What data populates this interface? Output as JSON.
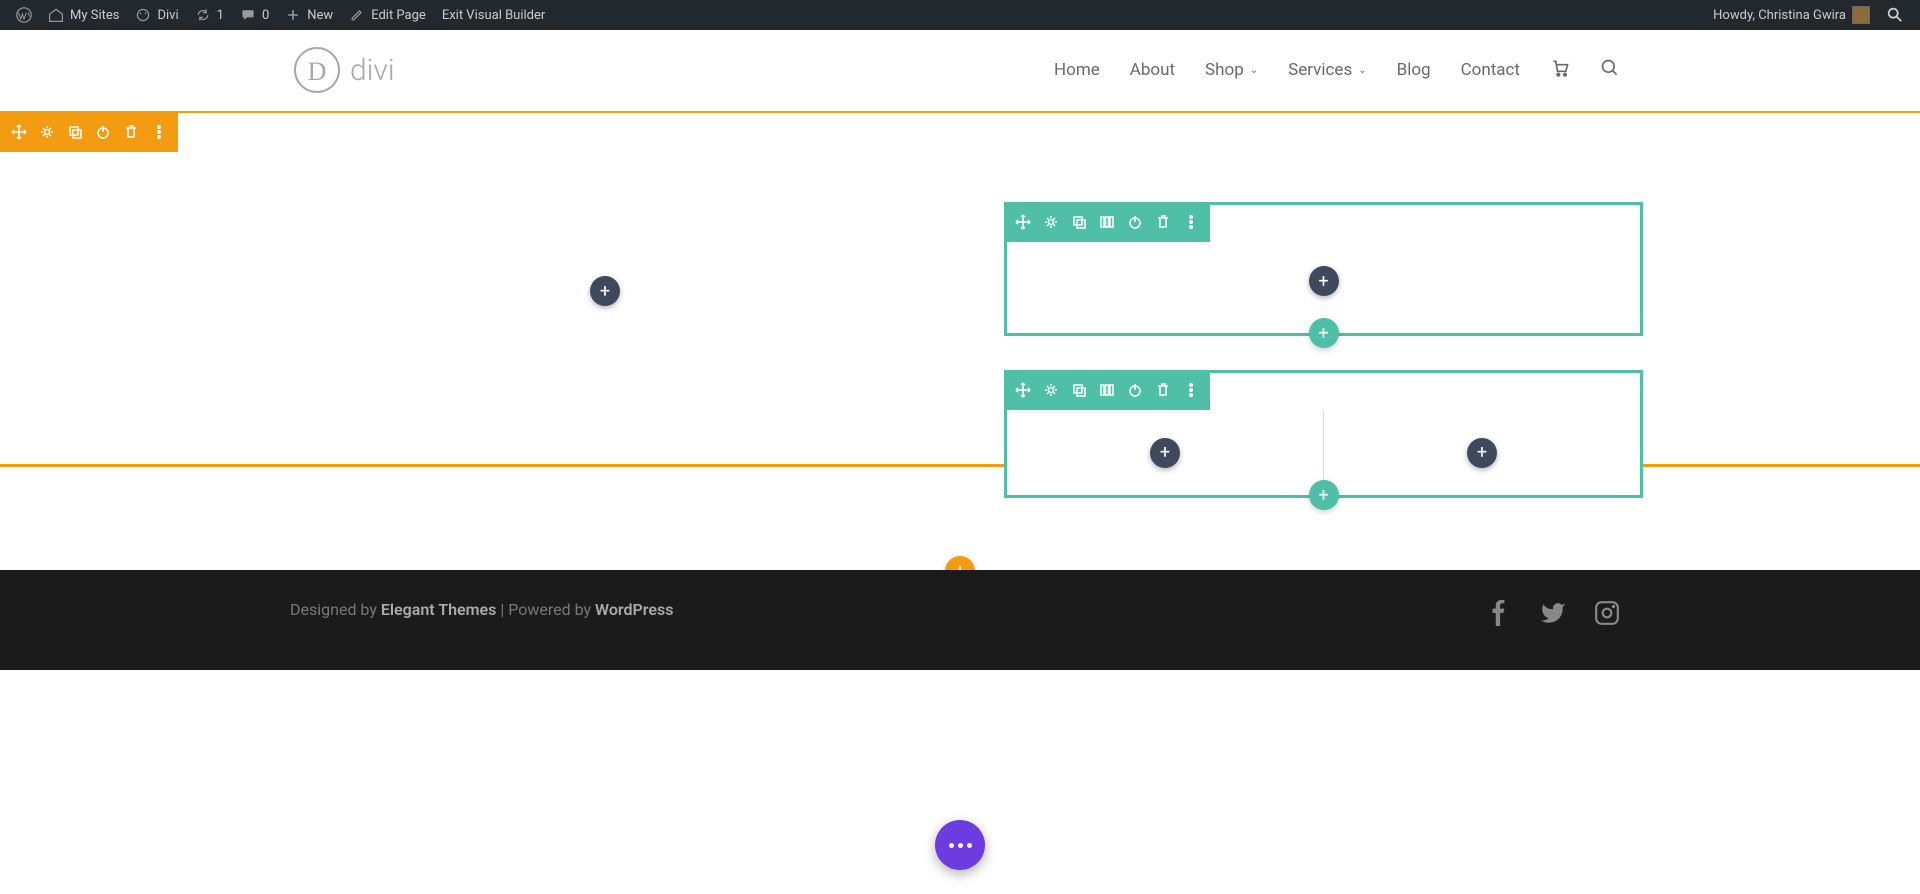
{
  "wp_bar": {
    "my_sites": "My Sites",
    "site_name": "Divi",
    "updates": "1",
    "comments": "0",
    "new": "New",
    "edit_page": "Edit Page",
    "exit_vb": "Exit Visual Builder",
    "howdy": "Howdy, Christina Gwira"
  },
  "nav": {
    "items": [
      "Home",
      "About",
      "Shop",
      "Services",
      "Blog",
      "Contact"
    ]
  },
  "footer": {
    "designed_by": "Designed by ",
    "elegant_themes": "Elegant Themes",
    "powered_by": " | Powered by ",
    "wordpress": "WordPress"
  }
}
